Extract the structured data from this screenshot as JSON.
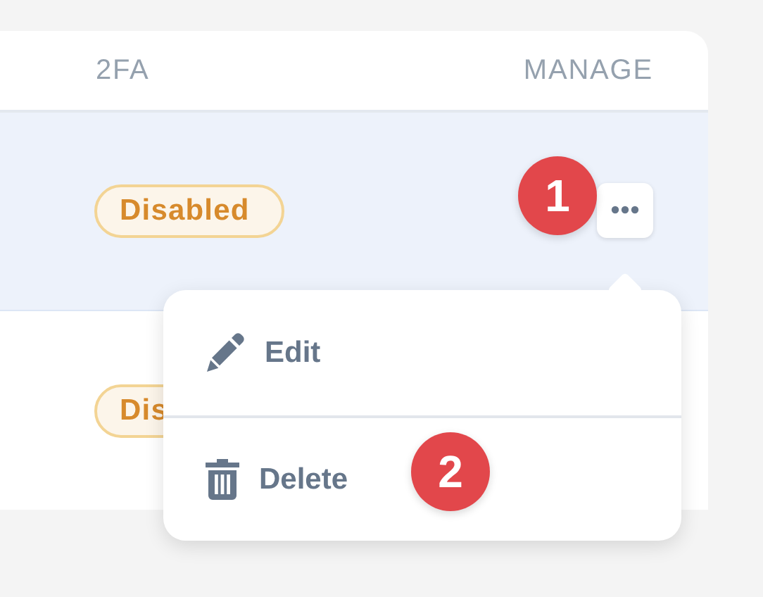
{
  "table": {
    "columns": [
      {
        "label": "2FA"
      },
      {
        "label": "MANAGE"
      }
    ],
    "rows": [
      {
        "status": "Disabled",
        "selected": true
      },
      {
        "status": "Dis",
        "selected": false
      }
    ]
  },
  "menu": {
    "open": true,
    "items": [
      {
        "label": "Edit",
        "kind": "edit"
      },
      {
        "label": "Delete",
        "kind": "delete"
      }
    ]
  },
  "callouts": [
    {
      "label": "1"
    },
    {
      "label": "2"
    }
  ]
}
